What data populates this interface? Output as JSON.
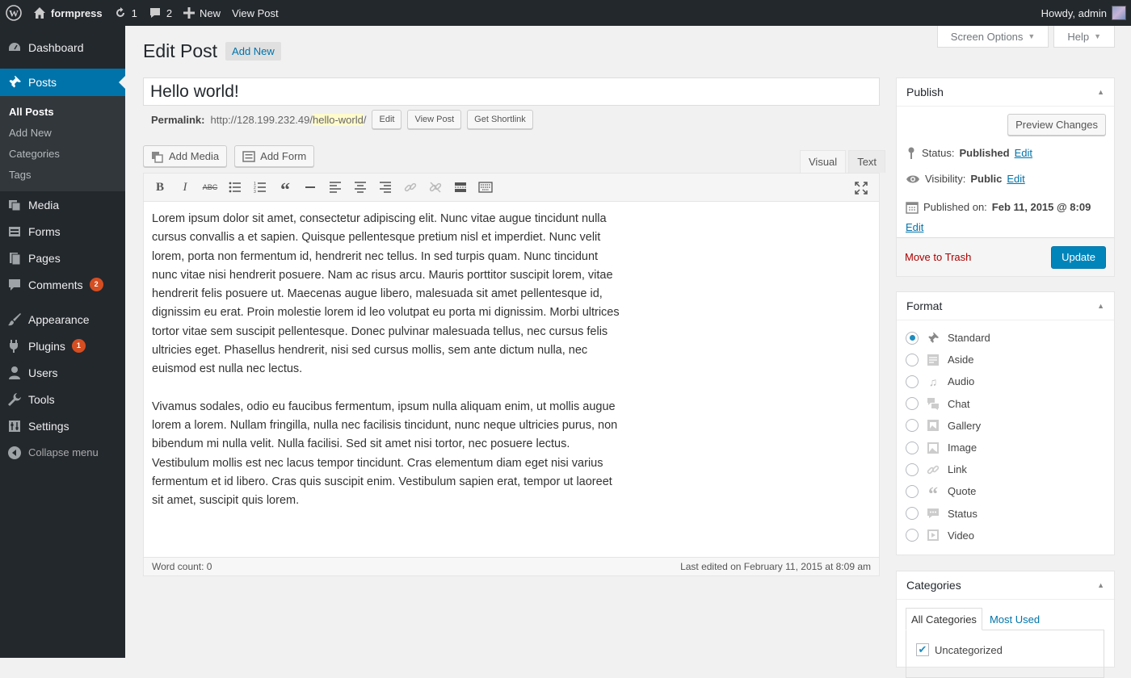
{
  "adminbar": {
    "site_name": "formpress",
    "updates_count": "1",
    "comments_count": "2",
    "new_label": "New",
    "view_post_label": "View Post",
    "howdy": "Howdy, admin"
  },
  "sidebar": {
    "dashboard": "Dashboard",
    "posts": "Posts",
    "posts_sub": [
      "All Posts",
      "Add New",
      "Categories",
      "Tags"
    ],
    "media": "Media",
    "forms": "Forms",
    "pages": "Pages",
    "comments": "Comments",
    "comments_badge": "2",
    "appearance": "Appearance",
    "plugins": "Plugins",
    "plugins_badge": "1",
    "users": "Users",
    "tools": "Tools",
    "settings": "Settings",
    "collapse": "Collapse menu"
  },
  "screen": {
    "options": "Screen Options",
    "help": "Help"
  },
  "header": {
    "title": "Edit Post",
    "add_new": "Add New"
  },
  "post": {
    "title": "Hello world!",
    "permalink_label": "Permalink:",
    "permalink_base": "http://128.199.232.49/",
    "permalink_slug": "hello-world",
    "permalink_end": "/",
    "edit_btn": "Edit",
    "view_btn": "View Post",
    "shortlink_btn": "Get Shortlink"
  },
  "editor": {
    "add_media": "Add Media",
    "add_form": "Add Form",
    "tab_visual": "Visual",
    "tab_text": "Text",
    "paragraph1": "Lorem ipsum dolor sit amet, consectetur adipiscing elit. Nunc vitae augue tincidunt nulla cursus convallis a et sapien. Quisque pellentesque pretium nisl et imperdiet. Nunc velit lorem, porta non fermentum id, hendrerit nec tellus. In sed turpis quam. Nunc tincidunt nunc vitae nisi hendrerit posuere. Nam ac risus arcu. Mauris porttitor suscipit lorem, vitae hendrerit felis posuere ut. Maecenas augue libero, malesuada sit amet pellentesque id, dignissim eu erat. Proin molestie lorem id leo volutpat eu porta mi dignissim. Morbi ultrices tortor vitae sem suscipit pellentesque. Donec pulvinar malesuada tellus, nec cursus felis ultricies eget. Phasellus hendrerit, nisi sed cursus mollis, sem ante dictum nulla, nec euismod est nulla nec lectus.",
    "paragraph2": "Vivamus sodales, odio eu faucibus fermentum, ipsum nulla aliquam enim, ut mollis augue lorem a lorem. Nullam fringilla, nulla nec facilisis tincidunt, nunc neque ultricies purus, non bibendum mi nulla velit. Nulla facilisi. Sed sit amet nisi tortor, nec posuere lectus. Vestibulum mollis est nec lacus tempor tincidunt. Cras elementum diam eget nisi varius fermentum et id libero. Cras quis suscipit enim. Vestibulum sapien erat, tempor ut laoreet sit amet, suscipit quis lorem.",
    "word_count": "Word count: 0",
    "last_edited": "Last edited on February 11, 2015 at 8:09 am"
  },
  "publish": {
    "title": "Publish",
    "preview": "Preview Changes",
    "status_label": "Status:",
    "status_value": "Published",
    "visibility_label": "Visibility:",
    "visibility_value": "Public",
    "published_label": "Published on:",
    "published_value": "Feb 11, 2015 @ 8:09",
    "edit": "Edit",
    "trash": "Move to Trash",
    "update": "Update"
  },
  "format": {
    "title": "Format",
    "options": [
      "Standard",
      "Aside",
      "Audio",
      "Chat",
      "Gallery",
      "Image",
      "Link",
      "Quote",
      "Status",
      "Video"
    ],
    "selected": "Standard"
  },
  "categories": {
    "title": "Categories",
    "tab_all": "All Categories",
    "tab_used": "Most Used",
    "item": "Uncategorized"
  }
}
